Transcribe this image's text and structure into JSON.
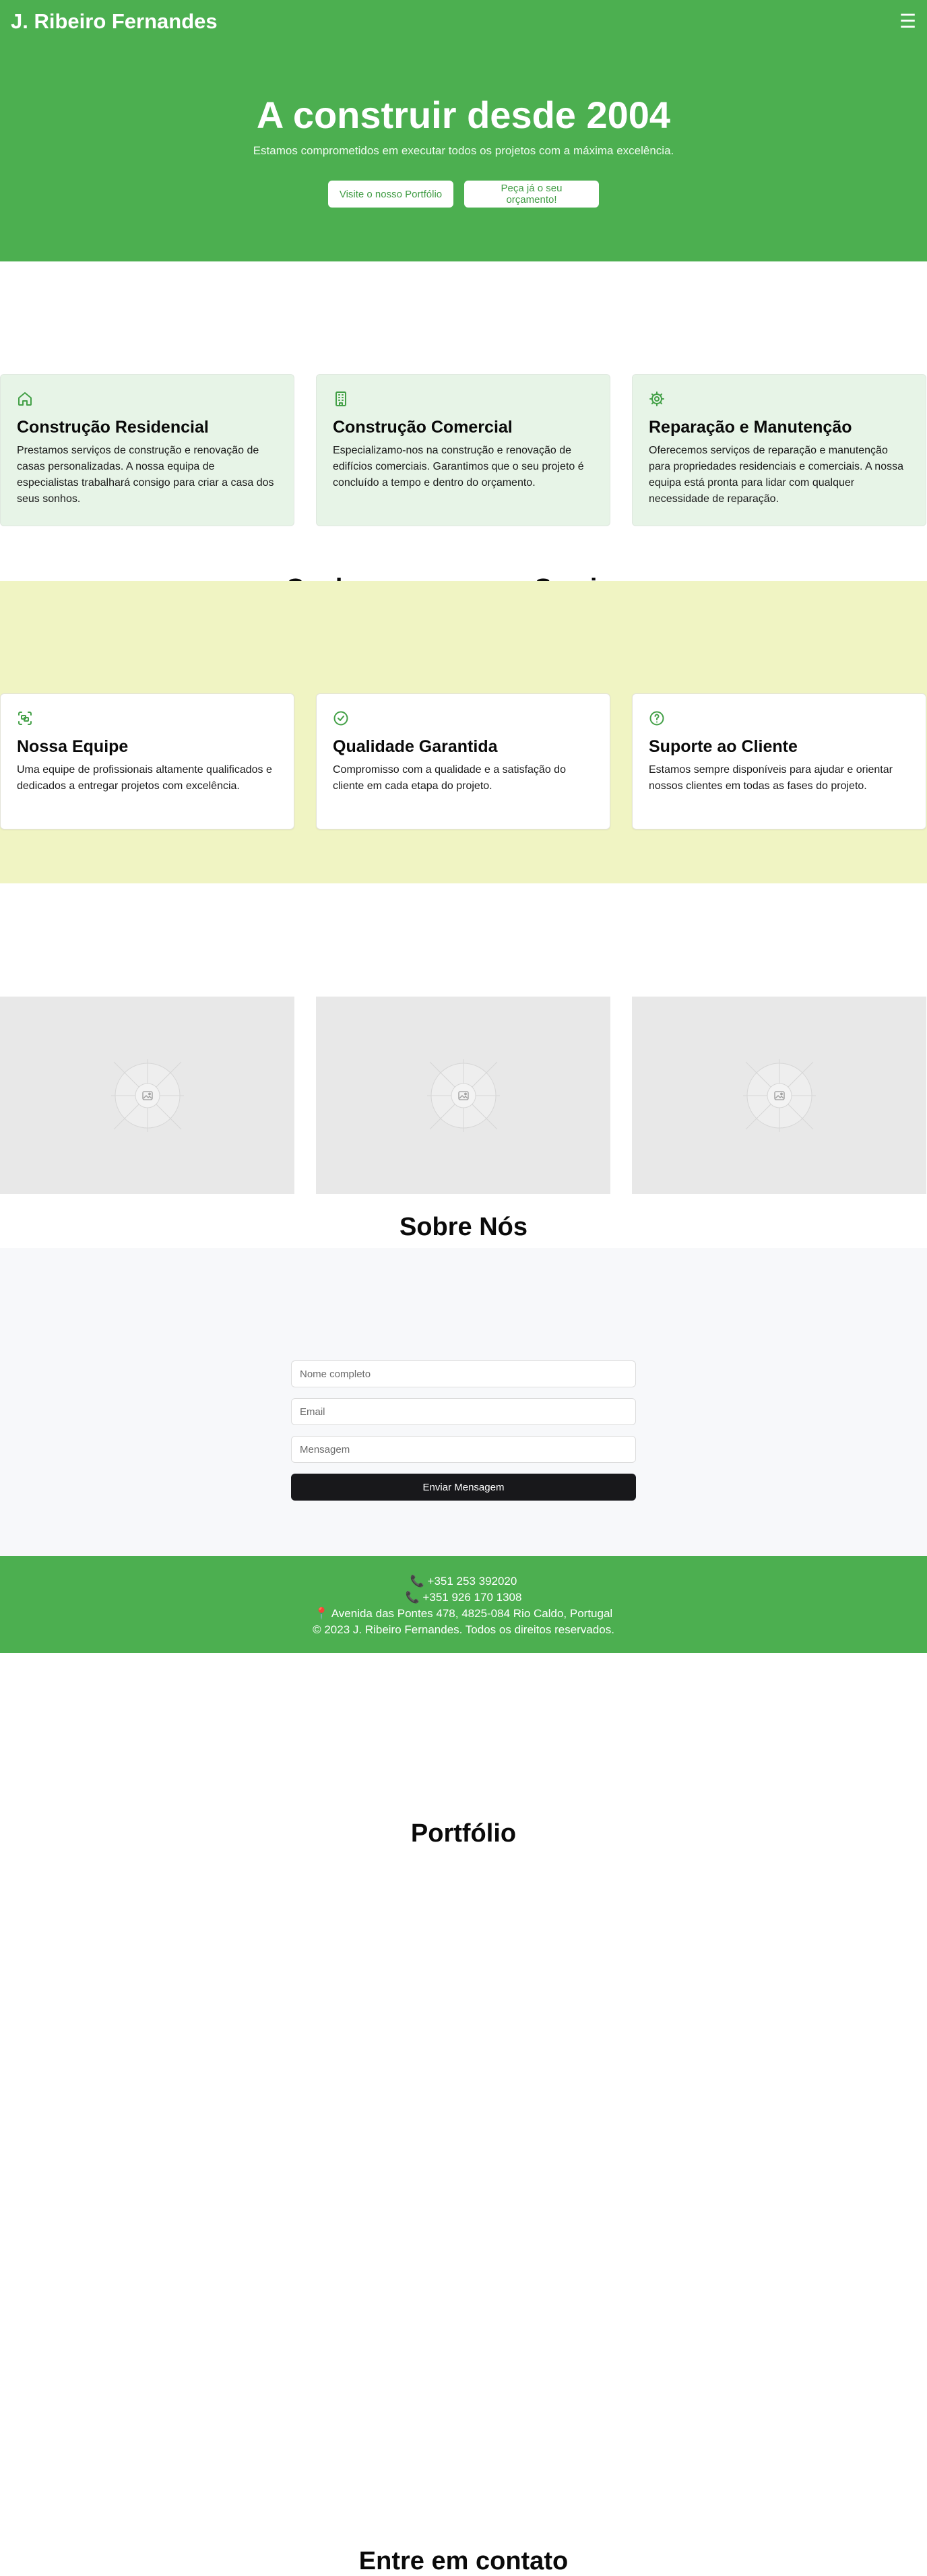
{
  "header": {
    "brand": "J. Ribeiro Fernandes",
    "menu_icon": "☰"
  },
  "hero": {
    "title": "A construir desde 2004",
    "subtitle": "Estamos comprometidos em executar todos os projetos com a máxima excelência.",
    "portfolio_button": "Visite o nosso Portfólio",
    "quote_button": "Peça já o seu orçamento!"
  },
  "services": {
    "title": "Conheça os nossos Serviços",
    "items": [
      {
        "icon": "house-icon",
        "title": "Construção Residencial",
        "text": "Prestamos serviços de construção e renovação de casas personalizadas. A nossa equipa de especialistas trabalhará consigo para criar a casa dos seus sonhos."
      },
      {
        "icon": "building-icon",
        "title": "Construção Comercial",
        "text": "Especializamo-nos na construção e renovação de edifícios comerciais. Garantimos que o seu projeto é concluído a tempo e dentro do orçamento."
      },
      {
        "icon": "gear-icon",
        "title": "Reparação e Manutenção",
        "text": "Oferecemos serviços de reparação e manutenção para propriedades residenciais e comerciais. A nossa equipa está pronta para lidar com qualquer necessidade de reparação."
      }
    ]
  },
  "about": {
    "title": "Sobre Nós",
    "items": [
      {
        "icon": "team-icon",
        "title": "Nossa Equipe",
        "text": "Uma equipe de profissionais altamente qualificados e dedicados a entregar projetos com excelência."
      },
      {
        "icon": "check-circle-icon",
        "title": "Qualidade Garantida",
        "text": "Compromisso com a qualidade e a satisfação do cliente em cada etapa do projeto."
      },
      {
        "icon": "help-circle-icon",
        "title": "Suporte ao Cliente",
        "text": "Estamos sempre disponíveis para ajudar e orientar nossos clientes em todas as fases do projeto."
      }
    ]
  },
  "portfolio": {
    "title": "Portfólio",
    "image_icon": "image-placeholder-icon"
  },
  "contact": {
    "title": "Entre em contato",
    "name_placeholder": "Nome completo",
    "email_placeholder": "Email",
    "message_placeholder": "Mensagem",
    "submit_label": "Enviar Mensagem"
  },
  "footer": {
    "phone1": "📞 +351 253 392020",
    "phone2": "📞 +351 926 170 1308",
    "address": "📍 Avenida das Pontes 478, 4825-084 Rio Caldo, Portugal",
    "copyright": "© 2023 J. Ribeiro Fernandes. Todos os direitos reservados."
  },
  "colors": {
    "primary": "#4caf50",
    "services_card_bg": "#e7f4e7",
    "about_bg": "#f0f4c3",
    "contact_bg": "#f7f8fa",
    "submit_bg": "#18181b"
  }
}
